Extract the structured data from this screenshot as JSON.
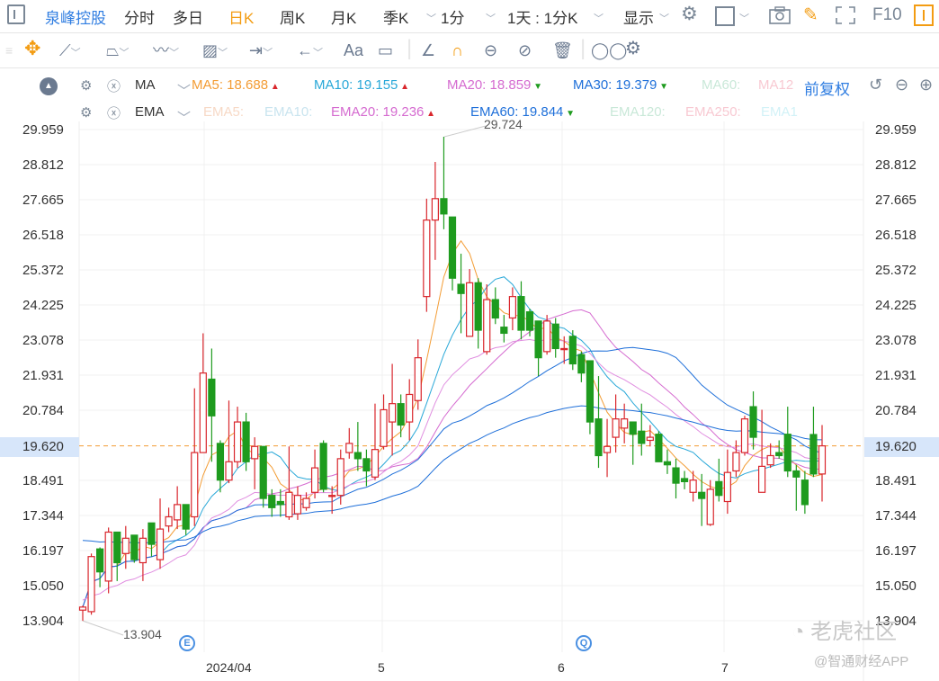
{
  "topbar": {
    "stock_name": "泉峰控股",
    "tabs": [
      "分时",
      "多日",
      "日K",
      "周K",
      "月K",
      "季K"
    ],
    "active_tab": "日K",
    "interval": "1分",
    "range": "1天 : 1分K",
    "display": "显示",
    "f10": "F10"
  },
  "drawbar": {
    "text_tool": "Aa"
  },
  "indicators": {
    "ma": {
      "name": "MA",
      "items": [
        {
          "label": "MA5: 18.688",
          "dir": "up",
          "color": "#f39c34"
        },
        {
          "label": "MA10: 19.155",
          "dir": "up",
          "color": "#29a8d8"
        },
        {
          "label": "MA20: 18.859",
          "dir": "down",
          "color": "#d56bd0"
        },
        {
          "label": "MA30: 19.379",
          "dir": "down",
          "color": "#1e6fd9"
        },
        {
          "label": "MA60:",
          "dir": "",
          "color": "#c9e8d8"
        },
        {
          "label": "MA12",
          "dir": "",
          "color": "#f8c9d2"
        }
      ],
      "adjust": "前复权"
    },
    "ema": {
      "name": "EMA",
      "items": [
        {
          "label": "EMA5:",
          "dir": "",
          "color": "#f7d9c6"
        },
        {
          "label": "EMA10:",
          "dir": "",
          "color": "#c9e4ef"
        },
        {
          "label": "EMA20: 19.236",
          "dir": "up",
          "color": "#d56bd0"
        },
        {
          "label": "EMA60: 19.844",
          "dir": "down",
          "color": "#1e6fd9"
        },
        {
          "label": "EMA120:",
          "dir": "",
          "color": "#c9e8d8"
        },
        {
          "label": "EMA250:",
          "dir": "",
          "color": "#f8c9d2"
        },
        {
          "label": "EMA1",
          "dir": "",
          "color": "#d2f2f7"
        }
      ]
    }
  },
  "chart_data": {
    "type": "candlestick",
    "y_ticks": [
      "29.959",
      "28.812",
      "27.665",
      "26.518",
      "25.372",
      "24.225",
      "23.078",
      "21.931",
      "20.784",
      "19.620",
      "18.491",
      "17.344",
      "16.197",
      "15.050",
      "13.904"
    ],
    "ylim": [
      13.904,
      29.959
    ],
    "current_price": "19.620",
    "x_labels": [
      "2024/04",
      "5",
      "6",
      "7"
    ],
    "max_label": "29.724",
    "min_label": "13.904",
    "event_markers": [
      "E",
      "Q"
    ],
    "up_color": "#d9262c",
    "down_color": "#1e9b1e",
    "ohlc": [
      [
        14.25,
        14.35,
        14.4,
        13.9
      ],
      [
        14.2,
        16.0,
        16.1,
        14.1
      ],
      [
        16.25,
        15.5,
        16.3,
        15.0
      ],
      [
        15.2,
        16.8,
        16.95,
        14.8
      ],
      [
        16.8,
        15.8,
        16.8,
        15.2
      ],
      [
        16.1,
        16.6,
        17.0,
        15.6
      ],
      [
        16.7,
        15.9,
        16.7,
        15.8
      ],
      [
        15.8,
        16.6,
        16.9,
        15.2
      ],
      [
        17.1,
        16.4,
        17.1,
        16.0
      ],
      [
        15.9,
        16.9,
        17.9,
        15.6
      ],
      [
        17.0,
        17.3,
        17.6,
        16.8
      ],
      [
        17.2,
        17.7,
        18.3,
        16.9
      ],
      [
        17.7,
        16.9,
        17.7,
        16.7
      ],
      [
        17.3,
        19.4,
        21.5,
        17.0
      ],
      [
        19.4,
        22.0,
        23.3,
        19.4
      ],
      [
        21.8,
        20.6,
        22.8,
        19.1
      ],
      [
        19.7,
        18.5,
        19.8,
        18.1
      ],
      [
        18.5,
        19.1,
        21.1,
        18.4
      ],
      [
        19.1,
        20.4,
        20.9,
        18.9
      ],
      [
        20.4,
        19.1,
        20.7,
        18.8
      ],
      [
        19.2,
        19.6,
        19.9,
        18.2
      ],
      [
        19.6,
        17.9,
        19.6,
        17.6
      ],
      [
        18.0,
        17.6,
        18.2,
        17.3
      ],
      [
        17.8,
        17.7,
        18.2,
        17.3
      ],
      [
        17.3,
        18.1,
        19.6,
        17.2
      ],
      [
        17.4,
        18.0,
        18.3,
        17.2
      ],
      [
        17.6,
        17.9,
        18.1,
        17.5
      ],
      [
        18.1,
        18.9,
        19.5,
        17.9
      ],
      [
        19.7,
        18.2,
        19.8,
        18.1
      ],
      [
        18.0,
        18.0,
        18.3,
        17.4
      ],
      [
        18.0,
        19.2,
        19.5,
        17.7
      ],
      [
        19.4,
        19.7,
        20.2,
        19.2
      ],
      [
        19.4,
        19.2,
        20.4,
        18.8
      ],
      [
        19.2,
        18.8,
        19.5,
        18.3
      ],
      [
        18.6,
        19.5,
        21.0,
        18.5
      ],
      [
        19.6,
        20.8,
        21.3,
        19.5
      ],
      [
        20.4,
        21.0,
        22.3,
        19.3
      ],
      [
        21.0,
        20.3,
        21.3,
        19.9
      ],
      [
        20.4,
        21.3,
        21.8,
        19.8
      ],
      [
        21.1,
        22.5,
        23.1,
        20.8
      ],
      [
        24.5,
        27.0,
        27.7,
        24.0
      ],
      [
        27.0,
        27.7,
        28.9,
        25.7
      ],
      [
        27.7,
        27.2,
        29.724,
        26.7
      ],
      [
        27.1,
        25.1,
        27.1,
        24.7
      ],
      [
        24.9,
        24.6,
        25.9,
        23.3
      ],
      [
        23.2,
        24.95,
        25.4,
        23.2
      ],
      [
        24.95,
        23.4,
        25.1,
        22.8
      ],
      [
        22.7,
        24.4,
        24.9,
        22.6
      ],
      [
        24.4,
        23.8,
        24.8,
        23.6
      ],
      [
        23.5,
        23.3,
        23.9,
        23.0
      ],
      [
        23.8,
        24.5,
        24.8,
        23.4
      ],
      [
        24.5,
        23.4,
        25.0,
        23.1
      ],
      [
        24.0,
        23.4,
        24.1,
        23.2
      ],
      [
        23.7,
        22.5,
        23.7,
        21.9
      ],
      [
        22.7,
        23.7,
        23.9,
        22.6
      ],
      [
        23.6,
        22.8,
        23.8,
        22.5
      ],
      [
        22.8,
        22.8,
        23.2,
        22.3
      ],
      [
        23.2,
        22.3,
        23.4,
        22.1
      ],
      [
        22.6,
        22.0,
        22.7,
        21.7
      ],
      [
        22.4,
        20.4,
        22.4,
        20.0
      ],
      [
        20.5,
        19.3,
        21.9,
        18.9
      ],
      [
        19.4,
        19.6,
        20.5,
        18.6
      ],
      [
        19.9,
        20.5,
        21.3,
        19.4
      ],
      [
        20.2,
        20.5,
        21.0,
        19.7
      ],
      [
        20.4,
        20.0,
        20.4,
        19.0
      ],
      [
        20.1,
        19.7,
        21.0,
        19.3
      ],
      [
        19.8,
        19.9,
        20.3,
        19.6
      ],
      [
        20.0,
        19.1,
        20.1,
        19.1
      ],
      [
        19.1,
        19.0,
        19.5,
        18.7
      ],
      [
        18.9,
        18.4,
        19.2,
        17.9
      ],
      [
        18.55,
        18.45,
        18.8,
        18.2
      ],
      [
        18.1,
        18.5,
        18.8,
        17.8
      ],
      [
        18.1,
        17.9,
        18.7,
        17.0
      ],
      [
        17.05,
        18.2,
        18.5,
        17.0
      ],
      [
        18.45,
        18.0,
        19.2,
        17.8
      ],
      [
        17.8,
        18.75,
        19.5,
        17.4
      ],
      [
        18.8,
        19.4,
        19.8,
        18.6
      ],
      [
        19.4,
        20.5,
        20.6,
        19.3
      ],
      [
        20.9,
        19.9,
        21.4,
        19.5
      ],
      [
        18.1,
        18.95,
        20.8,
        18.1
      ],
      [
        19.0,
        19.3,
        19.7,
        18.9
      ],
      [
        19.4,
        19.3,
        19.8,
        19.2
      ],
      [
        20.0,
        18.8,
        20.9,
        18.6
      ],
      [
        18.8,
        18.6,
        19.0,
        17.5
      ],
      [
        18.5,
        17.7,
        18.8,
        17.4
      ],
      [
        19.99,
        18.7,
        20.9,
        18.6
      ],
      [
        18.7,
        19.62,
        20.3,
        17.8
      ]
    ]
  },
  "watermark": {
    "logo_text": "老虎社区",
    "source": "@智通财经APP"
  }
}
